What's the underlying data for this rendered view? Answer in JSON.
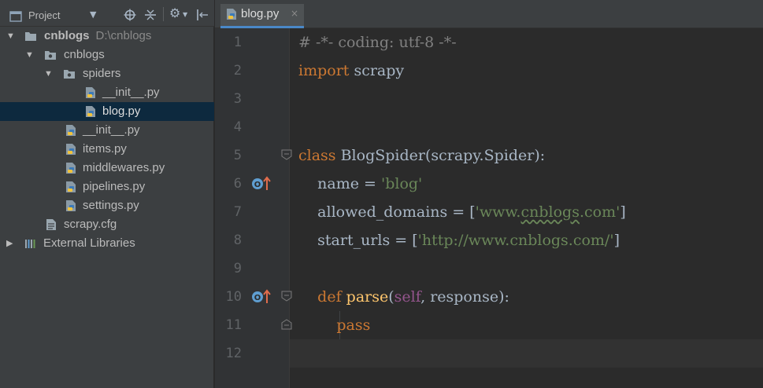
{
  "panel": {
    "title": "Project",
    "icons": [
      "project-icon",
      "chevron-down-icon",
      "locate-icon",
      "collapse-all-icon",
      "gear-icon",
      "hide-panel-icon"
    ]
  },
  "tree": {
    "items": [
      {
        "label": "cnblogs",
        "sub": "D:\\cnblogs",
        "icon": "folder-icon",
        "expanded": true
      },
      {
        "label": "cnblogs",
        "icon": "package-folder-icon",
        "expanded": true
      },
      {
        "label": "spiders",
        "icon": "package-folder-icon",
        "expanded": true
      },
      {
        "label": "__init__.py",
        "icon": "python-file-icon"
      },
      {
        "label": "blog.py",
        "icon": "python-file-icon",
        "selected": true
      },
      {
        "label": "__init__.py",
        "icon": "python-file-icon"
      },
      {
        "label": "items.py",
        "icon": "python-file-icon"
      },
      {
        "label": "middlewares.py",
        "icon": "python-file-icon"
      },
      {
        "label": "pipelines.py",
        "icon": "python-file-icon"
      },
      {
        "label": "settings.py",
        "icon": "python-file-icon"
      },
      {
        "label": "scrapy.cfg",
        "icon": "config-file-icon"
      },
      {
        "label": "External Libraries",
        "icon": "library-icon",
        "expanded": false
      }
    ]
  },
  "editor": {
    "tab": {
      "label": "blog.py",
      "close": "×"
    },
    "line_numbers": [
      "1",
      "2",
      "3",
      "4",
      "5",
      "6",
      "7",
      "8",
      "9",
      "10",
      "11",
      "12"
    ],
    "code": {
      "l1_comment": "# -*- coding: utf-8 -*-",
      "l2_kw": "import",
      "l2_rest": " scrapy",
      "l5_kw": "class",
      "l5_rest": " BlogSpider(scrapy.Spider):",
      "l6_name": "    name = ",
      "l6_str": "'blog'",
      "l7_name": "    allowed_domains = [",
      "l7_str_a": "'www.",
      "l7_str_b": "cnblogs",
      "l7_str_c": ".com'",
      "l7_end": "]",
      "l8_name": "    start_urls = [",
      "l8_str": "'http://www.cnblogs.com/'",
      "l8_end": "]",
      "l10_indent": "    ",
      "l10_kw": "def",
      "l10_sp": " ",
      "l10_fn": "parse",
      "l10_open": "(",
      "l10_self": "self",
      "l10_rest": ", response):",
      "l11_indent": "        ",
      "l11_kw": "pass"
    }
  },
  "colors": {
    "keyword": "#cc7832",
    "string": "#6a8759",
    "comment": "#808080",
    "function": "#ffc66d",
    "self": "#94558d",
    "selection": "#0d293e",
    "tab_underline": "#4a88c7"
  }
}
